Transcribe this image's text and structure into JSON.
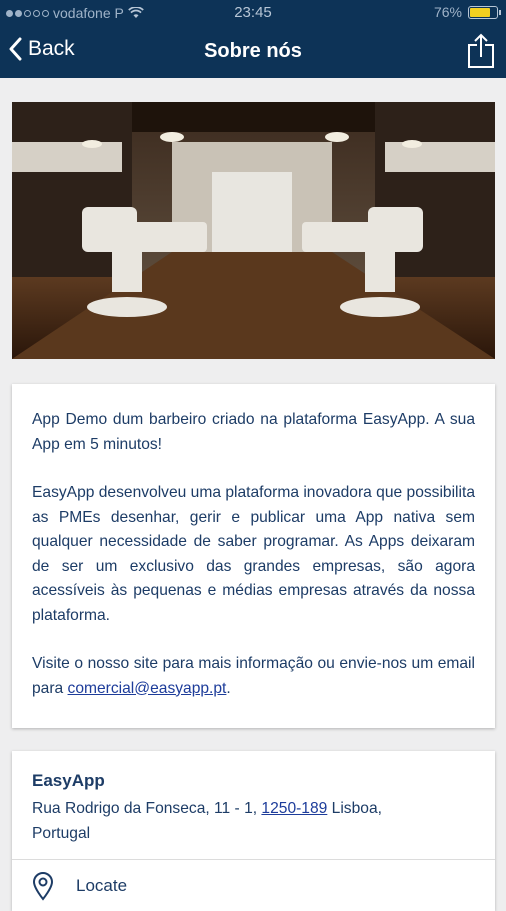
{
  "status_bar": {
    "carrier": "vodafone P",
    "time": "23:45",
    "battery": "76%",
    "battery_level": 0.76
  },
  "nav": {
    "back_label": "Back",
    "title": "Sobre nós"
  },
  "about": {
    "paragraph1": "App Demo dum barbeiro criado na plataforma EasyApp. A sua App em 5 minutos!",
    "paragraph2": "EasyApp desenvolveu uma plataforma inovadora que possibilita as PMEs desenhar, gerir e publicar uma App nativa sem qualquer necessidade de saber programar. As Apps deixaram de ser um exclusivo das grandes empresas, são agora acessíveis às pequenas e médias empresas através da nossa plataforma.",
    "paragraph3_prefix": "Visite o nosso site para mais informação ou envie-nos um email para ",
    "email": "comercial@easyapp.pt",
    "paragraph3_suffix": "."
  },
  "contact": {
    "name": "EasyApp",
    "address_line1": "Rua Rodrigo da Fonseca, 11 - 1, ",
    "postal_code": "1250-189",
    "address_line1_end": " Lisboa,",
    "address_line2": "Portugal",
    "locate_label": "Locate"
  },
  "colors": {
    "nav_bg": "#0d3357",
    "text": "#1d3c66",
    "link": "#1d3c9a",
    "battery": "#f3d020"
  }
}
